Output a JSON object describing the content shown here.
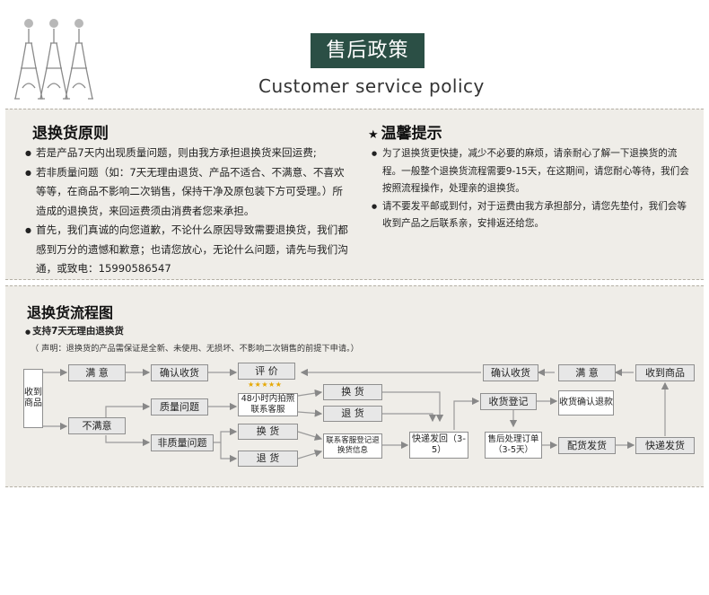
{
  "header": {
    "title": "售后政策",
    "subtitle": "Customer service policy"
  },
  "principles": {
    "heading": "退换货原则",
    "items": [
      "若是产品7天内出现质量问题，则由我方承担退换货来回运费;",
      "若非质量问题（如：7天无理由退货、产品不适合、不满意、不喜欢等等，在商品不影响二次销售，保持干净及原包装下方可受理。）所造成的退换货，来回运费须由消费者您来承担。",
      "首先，我们真诚的向您道歉，不论什么原因导致需要退换货，我们都感到万分的遗憾和歉意；也请您放心，无论什么问题，请先与我们沟通，或致电：15990586547"
    ]
  },
  "tips": {
    "heading": "温馨提示",
    "items": [
      "为了退换货更快捷，减少不必要的麻烦，请亲耐心了解一下退换货的流程。一般整个退换货流程需要9-15天，在这期间，请您耐心等待，我们会按照流程操作，处理亲的退换货。",
      "请不要发平邮或到付，对于运费由我方承担部分，请您先垫付，我们会等收到产品之后联系亲，安排返还给您。"
    ]
  },
  "flow": {
    "heading": "退换货流程图",
    "subheading": "支持7天无理由退换货",
    "note": "（ 声明：退换货的产品需保证是全新、未使用、无损坏、不影响二次销售的前提下申请。）",
    "boxes": {
      "received": "收到商品",
      "satisfied": "满 意",
      "confirm_receipt": "确认收货",
      "review": "评 价",
      "stars": "★★★★★",
      "unsatisfied": "不满意",
      "quality_issue": "质量问题",
      "contact_48h": "48小时内拍照联系客服",
      "exchange_1": "换 货",
      "return_1": "退 货",
      "non_quality": "非质量问题",
      "exchange_2": "换 货",
      "return_2": "退 货",
      "register_info": "联系客服登记退换货信息",
      "express_back": "快递发回（3-5）",
      "receive_register": "收货登记",
      "confirm_refund": "收货确认退款",
      "after_sale_order": "售后处理订单（3-5天）",
      "ship": "配货发货",
      "express_ship": "快递发货",
      "received_right": "收到商品",
      "satisfied_right": "满 意",
      "confirm_receipt_right": "确认收货"
    }
  },
  "colors": {
    "title_bg": "#2b4f45",
    "panel_bg": "#efede8",
    "star": "#e6a800"
  }
}
